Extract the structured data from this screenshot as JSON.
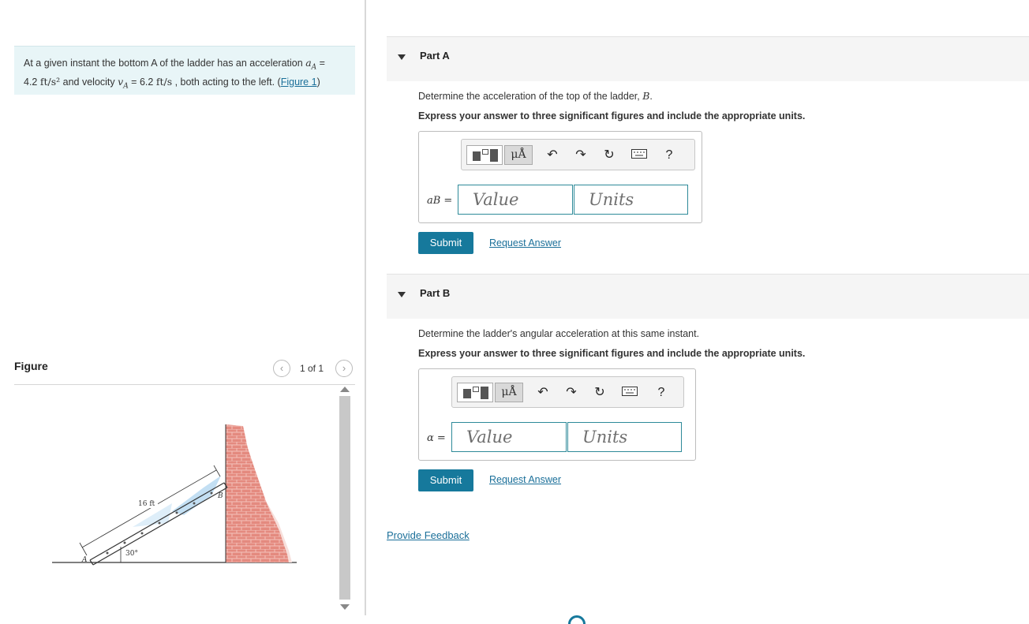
{
  "problem": {
    "text_before": "At a given instant the bottom A of the ladder has an acceleration ",
    "accel_symbol": "aA",
    "line2_value_accel": "4.2",
    "accel_units": "ft/s²",
    "text_mid": " and velocity ",
    "vel_symbol": "vA",
    "vel_value": "6.2",
    "vel_units": "ft/s",
    "text_after": " , both acting to the left. (",
    "figure_link": "Figure 1",
    "close_paren": ")"
  },
  "figure": {
    "title": "Figure",
    "count": "1 of 1",
    "prev_icon": "chevron-left-icon",
    "next_icon": "chevron-right-icon",
    "length_label": "16 ft",
    "angle_label": "30°",
    "point_a": "A",
    "point_b": "B"
  },
  "parts": [
    {
      "title": "Part A",
      "question_before": "Determine the acceleration of the top of the ladder, ",
      "question_symbol": "B",
      "question_after": ".",
      "instruction": "Express your answer to three significant figures and include the appropriate units.",
      "answer_label": "aB =",
      "value_placeholder": "Value",
      "units_placeholder": "Units",
      "submit": "Submit",
      "request": "Request Answer"
    },
    {
      "title": "Part B",
      "question_before": "Determine the ladder's angular acceleration at this same instant.",
      "question_symbol": "",
      "question_after": "",
      "instruction": "Express your answer to three significant figures and include the appropriate units.",
      "answer_label": "α =",
      "value_placeholder": "Value",
      "units_placeholder": "Units",
      "submit": "Submit",
      "request": "Request Answer"
    }
  ],
  "toolbar": {
    "mu_label": "μÅ",
    "help_label": "?"
  },
  "feedback": "Provide Feedback"
}
